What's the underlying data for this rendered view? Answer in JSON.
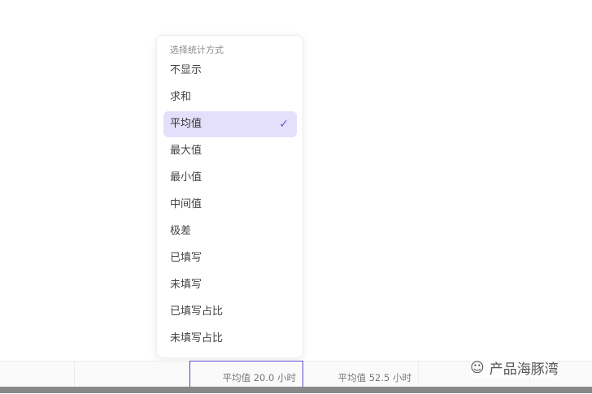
{
  "menu": {
    "title": "选择统计方式",
    "items": [
      {
        "label": "不显示"
      },
      {
        "label": "求和"
      },
      {
        "label": "平均值",
        "selected": true
      },
      {
        "label": "最大值"
      },
      {
        "label": "最小值"
      },
      {
        "label": "中间值"
      },
      {
        "label": "极差"
      },
      {
        "label": "已填写"
      },
      {
        "label": "未填写"
      },
      {
        "label": "已填写占比"
      },
      {
        "label": "未填写占比"
      }
    ]
  },
  "footer": {
    "cells": [
      "平均值 20.0 小时",
      "平均值 52.5 小时"
    ]
  },
  "watermark": "产品海豚湾",
  "colors": {
    "accent": "#5b4bd0",
    "selected_bg": "#e4e0fb"
  }
}
